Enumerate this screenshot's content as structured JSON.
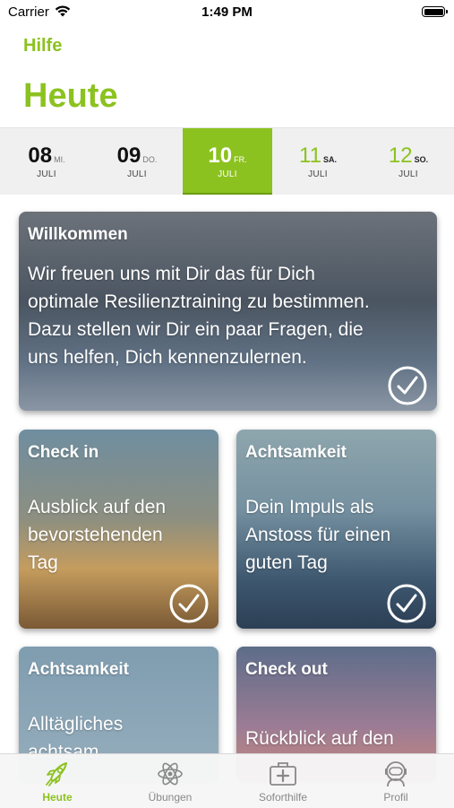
{
  "status": {
    "carrier": "Carrier",
    "time": "1:49 PM"
  },
  "header": {
    "help": "Hilfe",
    "title": "Heute"
  },
  "dates": [
    {
      "num": "08",
      "weekday": "MI.",
      "month": "JULI",
      "selected": false
    },
    {
      "num": "09",
      "weekday": "DO.",
      "month": "JULI",
      "selected": false
    },
    {
      "num": "10",
      "weekday": "FR.",
      "month": "JULI",
      "selected": true
    },
    {
      "num": "11",
      "weekday": "SA.",
      "month": "JULI",
      "selected": false
    },
    {
      "num": "12",
      "weekday": "SO.",
      "month": "JULI",
      "selected": false
    }
  ],
  "cards": [
    {
      "title": "Willkommen",
      "text": "Wir freuen uns mit Dir das für Dich\noptimale Resilienztraining zu bestimmen.\nDazu stellen wir Dir ein paar Fragen, die\nuns helfen, Dich kennenzulernen.",
      "done": true
    },
    {
      "title": "Check in",
      "text": "Ausblick auf den\nbevorstehenden\nTag",
      "done": true
    },
    {
      "title": "Achtsamkeit",
      "text": "Dein Impuls als\nAnstoss für einen\nguten Tag",
      "done": true
    },
    {
      "title": "Achtsamkeit",
      "text": "Alltägliches\nachtsam",
      "done": false
    },
    {
      "title": "Check out",
      "text": "Rückblick auf den",
      "done": false
    }
  ],
  "tabs": [
    {
      "label": "Heute",
      "icon": "rocket-icon",
      "active": true
    },
    {
      "label": "Übungen",
      "icon": "atom-icon",
      "active": false
    },
    {
      "label": "Soforthilfe",
      "icon": "first-aid-kit-icon",
      "active": false
    },
    {
      "label": "Profil",
      "icon": "astronaut-icon",
      "active": false
    }
  ],
  "colors": {
    "accent": "#8cc21f",
    "tab_inactive": "#888888"
  }
}
